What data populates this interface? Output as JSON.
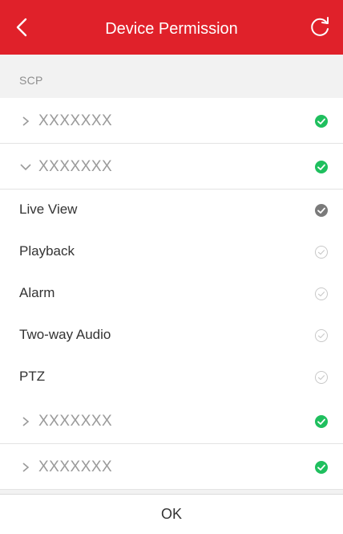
{
  "header": {
    "title": "Device Permission",
    "back_icon": "chevron-left-icon",
    "refresh_icon": "refresh-icon",
    "bg_color": "#e0212a"
  },
  "section": {
    "label": "SCP"
  },
  "devices": [
    {
      "name": "XXXXXXX",
      "expanded": false,
      "checked": true
    },
    {
      "name": "XXXXXXX",
      "expanded": true,
      "checked": true
    },
    {
      "name": "XXXXXXX",
      "expanded": false,
      "checked": true
    },
    {
      "name": "XXXXXXX",
      "expanded": false,
      "checked": true
    }
  ],
  "permissions": [
    {
      "label": "Live View",
      "state": "checked"
    },
    {
      "label": "Playback",
      "state": "unchecked"
    },
    {
      "label": "Alarm",
      "state": "unchecked"
    },
    {
      "label": "Two-way Audio",
      "state": "unchecked"
    },
    {
      "label": "PTZ",
      "state": "unchecked"
    }
  ],
  "colors": {
    "device_checked": "#1fbf5e",
    "permission_checked": "#7a7a7a",
    "unchecked": "#c8c8c8"
  },
  "footer": {
    "ok_label": "OK"
  }
}
